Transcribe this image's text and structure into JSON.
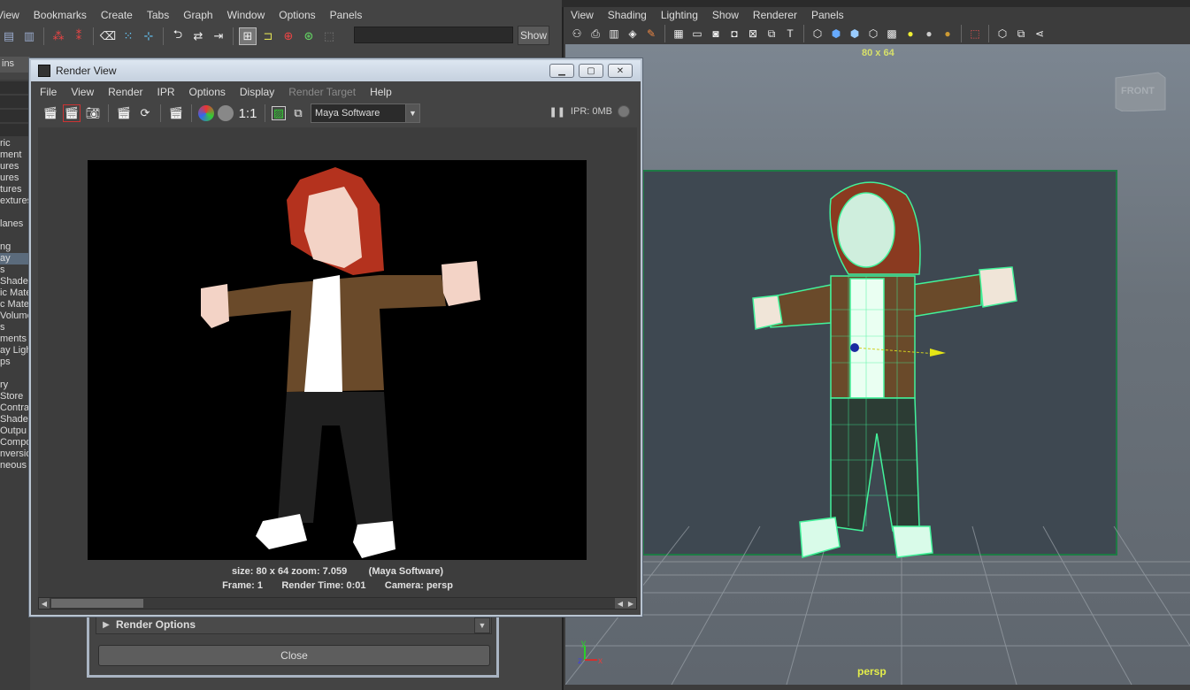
{
  "hypershade": {
    "menu": [
      "View",
      "Bookmarks",
      "Create",
      "Tabs",
      "Graph",
      "Window",
      "Options",
      "Panels"
    ],
    "show_label": "Show",
    "search_value": "",
    "tab_label": "ins",
    "list_items": [
      "ric",
      "ment",
      "ures",
      "ures",
      "tures",
      "extures",
      "",
      "lanes",
      "",
      "ng",
      "ay",
      "s",
      "Shade",
      "ic Mate",
      "c Mater",
      "Volume",
      "s",
      "ments",
      "ay Ligh",
      "ps",
      "",
      "ry",
      "Store",
      "Contra",
      "Shade",
      "Outpu",
      "Compo",
      "nversio",
      "neous"
    ],
    "render_options_label": "Render Options",
    "close_label": "Close"
  },
  "viewport": {
    "menu": [
      "View",
      "Shading",
      "Lighting",
      "Show",
      "Renderer",
      "Panels"
    ],
    "resolution_label": "80 x 64",
    "camera_label": "persp",
    "viewcube_label": "FRONT"
  },
  "render_view": {
    "title": "Render View",
    "menu": [
      "File",
      "View",
      "Render",
      "IPR",
      "Options",
      "Display",
      "Render Target",
      "Help"
    ],
    "ratio_label": "1:1",
    "renderer": "Maya Software",
    "ipr_status": "IPR: 0MB",
    "info_line1": "size: 80 x 64 zoom: 7.059        (Maya Software)",
    "info_line2": "Frame: 1       Render Time: 0:01       Camera: persp"
  },
  "colors": {
    "hair": "#b4321e",
    "skin": "#f3d3c6",
    "jacket": "#6a4a2a",
    "shirt": "#ffffff",
    "pants": "#202020",
    "wireframe": "#42f29a"
  }
}
